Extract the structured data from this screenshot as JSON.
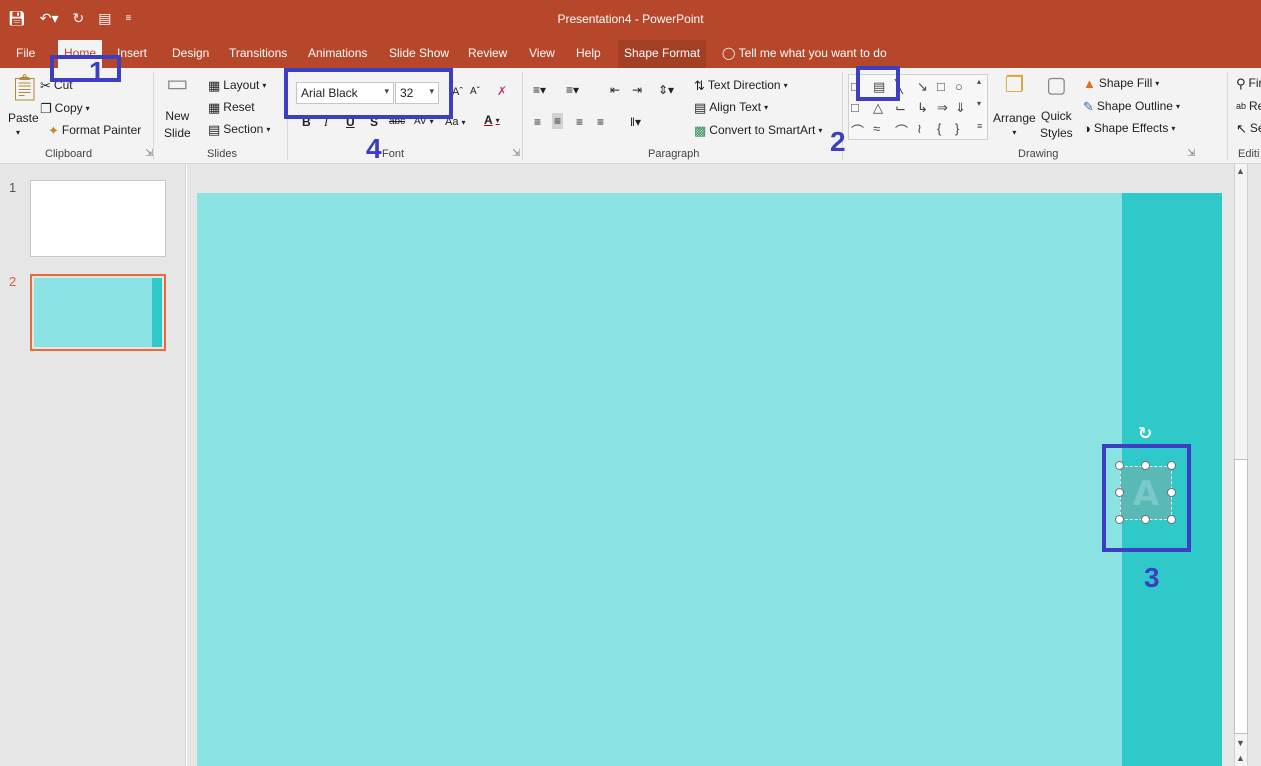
{
  "window": {
    "title": "Presentation4 - PowerPoint"
  },
  "qat": {
    "save_icon": "save-icon",
    "undo_icon": "undo-icon",
    "redo_icon": "redo-icon",
    "present_icon": "present-from-start-icon"
  },
  "tabs": [
    {
      "label": "File"
    },
    {
      "label": "Home"
    },
    {
      "label": "Insert"
    },
    {
      "label": "Design"
    },
    {
      "label": "Transitions"
    },
    {
      "label": "Animations"
    },
    {
      "label": "Slide Show"
    },
    {
      "label": "Review"
    },
    {
      "label": "View"
    },
    {
      "label": "Help"
    },
    {
      "label": "Shape Format"
    }
  ],
  "tell_me": "Tell me what you want to do",
  "clipboard": {
    "paste": "Paste",
    "cut": "Cut",
    "copy": "Copy",
    "format_painter": "Format Painter",
    "label": "Clipboard"
  },
  "slides_group": {
    "new_slide_1": "New",
    "new_slide_2": "Slide",
    "layout": "Layout",
    "reset": "Reset",
    "section": "Section",
    "label": "Slides"
  },
  "font": {
    "name": "Arial Black",
    "size": "32",
    "label": "Font",
    "bold": "B",
    "italic": "I",
    "underline": "U",
    "shadow": "S",
    "strike": "abc",
    "spacing": "AV",
    "case": "Aa",
    "color": "A"
  },
  "paragraph": {
    "text_direction": "Text Direction",
    "align_text": "Align Text",
    "smartart": "Convert to SmartArt",
    "label": "Paragraph"
  },
  "drawing": {
    "arrange": "Arrange",
    "quick_1": "Quick",
    "quick_2": "Styles",
    "fill": "Shape Fill",
    "outline": "Shape Outline",
    "effects": "Shape Effects",
    "label": "Drawing"
  },
  "editing": {
    "find": "Find",
    "replace": "Rep",
    "select": "Sele",
    "label": "Editi"
  },
  "slides": [
    {
      "number": "1"
    },
    {
      "number": "2"
    }
  ],
  "textbox": {
    "letter": "A"
  },
  "annotations": [
    {
      "number": "1"
    },
    {
      "number": "2"
    },
    {
      "number": "3"
    },
    {
      "number": "4"
    }
  ],
  "colors": {
    "accent": "#b7472a",
    "slide_bg": "#8ae2e2",
    "slide_bar": "#2fc9c9",
    "annotation": "#3c3fc2"
  }
}
